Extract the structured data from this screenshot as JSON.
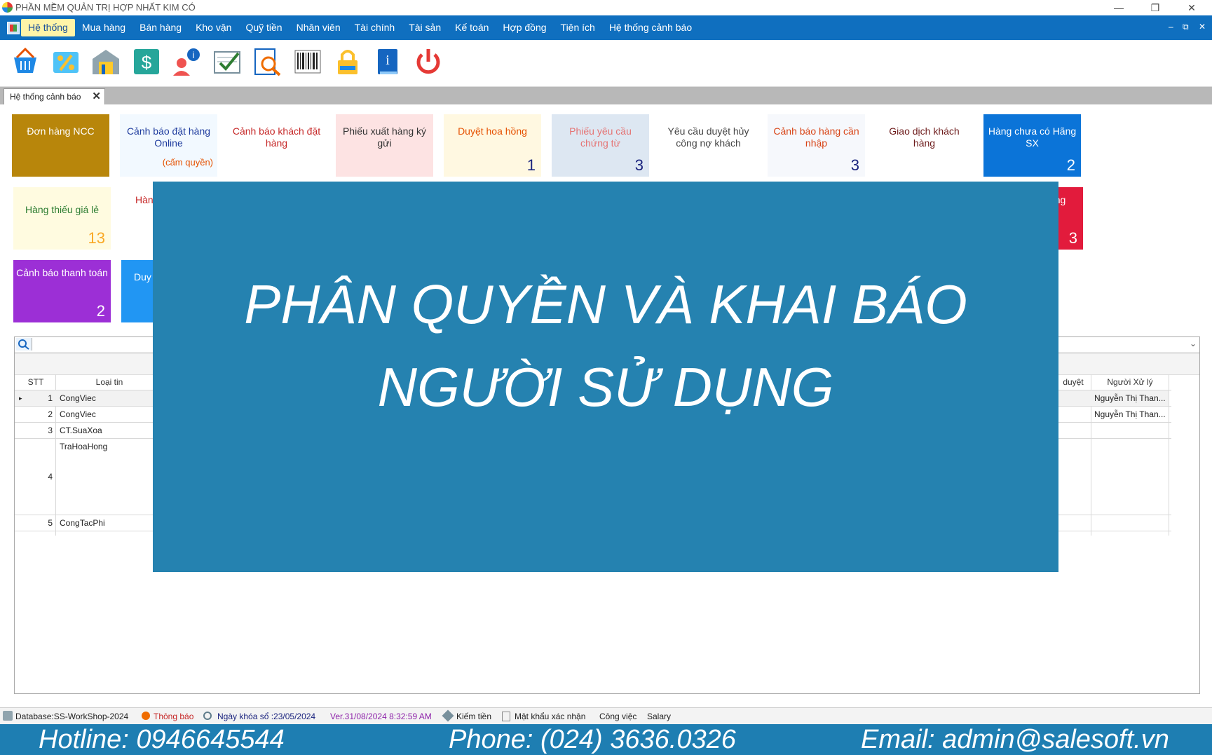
{
  "window": {
    "title": "PHẦN MỀM QUẢN TRỊ HỢP NHẤT KIM CÓ",
    "minimize_glyph": "—",
    "restore_glyph": "❐",
    "close_glyph": "✕"
  },
  "menu": {
    "items": [
      "Hệ thống",
      "Mua hàng",
      "Bán hàng",
      "Kho vận",
      "Quỹ tiền",
      "Nhân viên",
      "Tài chính",
      "Tài sản",
      "Kế toán",
      "Hợp đồng",
      "Tiện ích",
      "Hệ thống cảnh báo"
    ],
    "active_index": 0,
    "mdi_controls": [
      "–",
      "⧉",
      "✕"
    ]
  },
  "toolbar": {
    "icons": [
      "basket-icon",
      "percent-icon",
      "warehouse-icon",
      "money-icon",
      "user-info-icon",
      "checklist-icon",
      "search-doc-icon",
      "barcode-icon",
      "lock-icon",
      "info-book-icon",
      "power-icon"
    ]
  },
  "tab": {
    "label": "Hệ thống cảnh báo",
    "close": "✕"
  },
  "tiles": [
    {
      "label": "Đơn hàng NCC",
      "count": "",
      "note": "",
      "bg": "#b8860b",
      "fg": "#ffffff"
    },
    {
      "label": "Cảnh báo đặt hàng Online",
      "count": "",
      "note": "(cấm quyền)",
      "bg": "#f2f9ff",
      "fg": "#1f3c9e"
    },
    {
      "label": "Cảnh báo khách đặt hàng",
      "count": "",
      "note": "",
      "bg": "#ffffff",
      "fg": "#c62828"
    },
    {
      "label": "Phiếu xuất hàng ký gửi",
      "count": "",
      "note": "",
      "bg": "#fde3e3",
      "fg": "#333333"
    },
    {
      "label": "Duyệt hoa hồng",
      "count": "1",
      "note": "",
      "bg": "#fff8e1",
      "fg": "#e65100"
    },
    {
      "label": "Phiếu yêu cầu chứng từ",
      "count": "3",
      "note": "",
      "bg": "#dde7f2",
      "fg": "#e57373"
    },
    {
      "label": "Yêu cầu duyệt hủy công nợ khách",
      "count": "",
      "note": "",
      "bg": "#ffffff",
      "fg": "#444444"
    },
    {
      "label": "Cảnh báo hàng cần nhập",
      "count": "3",
      "note": "",
      "bg": "#f6f8fc",
      "fg": "#d84315"
    },
    {
      "label": "Giao dịch khách hàng",
      "count": "",
      "note": "",
      "bg": "#ffffff",
      "fg": "#6d1b1b"
    },
    {
      "label": "Hàng chưa có Hãng SX",
      "count": "2",
      "note": "",
      "bg": "#0b74d8",
      "fg": "#ffffff"
    },
    {
      "label": "Hàng thiếu giá lẻ",
      "count": "13",
      "note": "",
      "bg": "#fffbe0",
      "fg": "#2e7d32"
    },
    {
      "label": "Hàn",
      "count": "",
      "note": "",
      "bg": "#ffffff",
      "fg": "#c62828"
    },
    {
      "label": "ng",
      "count": "3",
      "note": "",
      "bg": "#e21b3c",
      "fg": "#ffffff"
    },
    {
      "label": "Cảnh báo thanh toán",
      "count": "2",
      "note": "",
      "bg": "#9c2fd6",
      "fg": "#ffffff"
    },
    {
      "label": "Duy",
      "count": "",
      "note": "",
      "bg": "#2196f3",
      "fg": "#ffffff"
    }
  ],
  "grid": {
    "headers": {
      "stt": "STT",
      "loai_tin": "Loại tin",
      "duyet": "duyệt",
      "nguoi_xu_ly": "Người Xử lý"
    },
    "rows": [
      {
        "stt": "1",
        "loai_tin": "CongViec",
        "nguoi_xu_ly": "Nguyễn Thị Than..."
      },
      {
        "stt": "2",
        "loai_tin": "CongViec",
        "nguoi_xu_ly": "Nguyễn Thị Than..."
      },
      {
        "stt": "3",
        "loai_tin": "CT.SuaXoa",
        "nguoi_xu_ly": ""
      },
      {
        "stt": "4",
        "loai_tin": "TraHoaHong",
        "nguoi_xu_ly": ""
      },
      {
        "stt": "5",
        "loai_tin": "CongTacPhi",
        "nguoi_xu_ly": ""
      }
    ],
    "selected_marker": "▸"
  },
  "statusbar": {
    "database": "Database:SS-WorkShop-2024",
    "thong_bao": "Thông báo",
    "ngay_khoa_so": "Ngày khóa sổ :23/05/2024",
    "version": "Ver.31/08/2024 8:32:59 AM",
    "kiem_tien": "Kiếm tiền",
    "mat_khau": "Mật khẩu xác nhận",
    "cong_viec": "Công việc",
    "salary": "Salary"
  },
  "footer": {
    "hotline": "Hotline: 0946645544",
    "phone": "Phone: (024) 3636.0326",
    "email": "Email: admin@salesoft.vn"
  },
  "overlay": {
    "line1": "PHÂN QUYỀN VÀ KHAI BÁO",
    "line2": "NGƯỜI SỬ DỤNG"
  },
  "colors": {
    "menubar": "#0f6fbf",
    "overlay": "#2582b0",
    "footer": "#1e7eb2"
  }
}
